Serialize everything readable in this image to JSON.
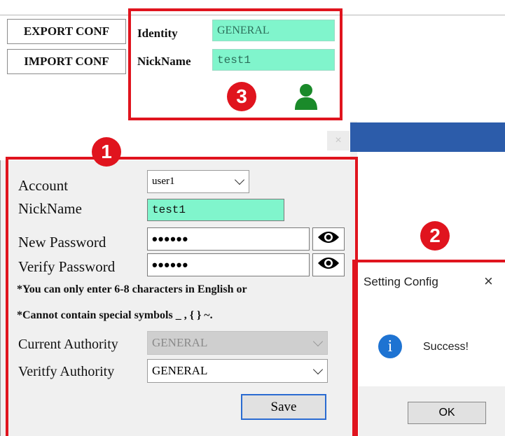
{
  "toolbar": {
    "export_label": "EXPORT CONF",
    "import_label": "IMPORT CONF"
  },
  "profile": {
    "identity_label": "Identity",
    "identity_value": "GENERAL",
    "nickname_label": "NickName",
    "nickname_value": "test1",
    "user_icon_color": "#1a8a2a"
  },
  "config_dialog": {
    "close_glyph": "×",
    "account_label": "Account",
    "account_value": "user1",
    "nickname_label": "NickName",
    "nickname_value": "test1",
    "new_password_label": "New Password",
    "new_password_value": "••••••",
    "verify_password_label": "Verify Password",
    "verify_password_value": "••••••",
    "note_1": "*You can only enter 6-8 characters in English or",
    "note_2": "*Cannot contain special symbols _ , { } ~.",
    "current_authority_label": "Current Authority",
    "current_authority_value": "GENERAL",
    "verify_authority_label": "Veritfy Authority",
    "verify_authority_value": "GENERAL",
    "save_label": "Save"
  },
  "message_box": {
    "title": "Setting Config",
    "close_glyph": "×",
    "icon_glyph": "i",
    "message": "Success!",
    "ok_label": "OK"
  },
  "annotations": {
    "badge_1": "1",
    "badge_2": "2",
    "badge_3": "3",
    "color": "#e0141e"
  }
}
